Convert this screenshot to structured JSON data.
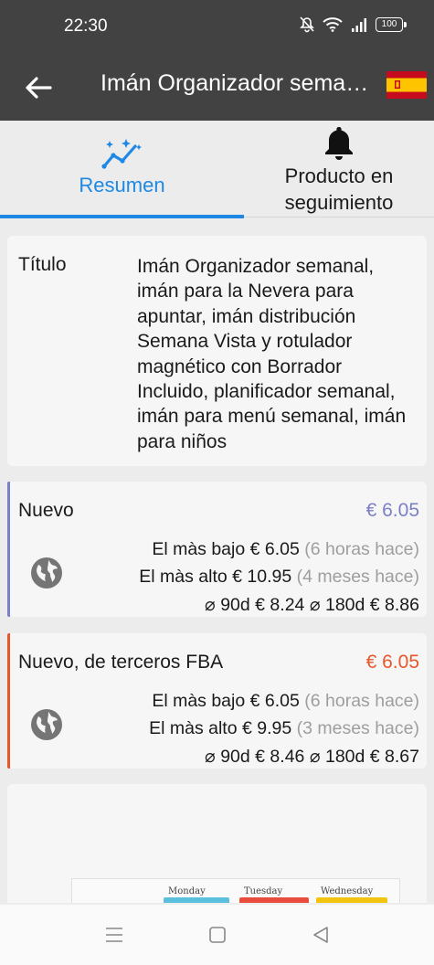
{
  "status_bar": {
    "time": "22:30",
    "battery": "100"
  },
  "app_bar": {
    "title": "Imán Organizador semanal, imán para la Nevera para apuntar"
  },
  "tabs": [
    {
      "label": "Resumen",
      "icon": "trend-sparkle-icon",
      "selected": true
    },
    {
      "label": "Producto en seguimiento",
      "icon": "bell-icon",
      "selected": false
    }
  ],
  "title_card": {
    "label": "Título",
    "value": "Imán Organizador semanal, imán para la Nevera para apuntar, imán distribución Semana Vista y rotulador magnético con Borrador Incluido, planificador semanal, imán para menú semanal, imán para niños"
  },
  "prices": [
    {
      "name": "Nuevo",
      "price": "€ 6.05",
      "color": "#7b7fc4",
      "lowest_label": "El màs bajo",
      "lowest_value": "€ 6.05",
      "lowest_when": "(6 horas hace)",
      "highest_label": "El màs alto",
      "highest_value": "€ 10.95",
      "highest_when": "(4 meses hace)",
      "avg90_label": "⌀ 90d",
      "avg90_value": "€ 8.24",
      "avg180_label": "⌀ 180d",
      "avg180_value": "€ 8.86"
    },
    {
      "name": "Nuevo, de terceros FBA",
      "price": "€ 6.05",
      "color": "#e8572a",
      "lowest_label": "El màs bajo",
      "lowest_value": "€ 6.05",
      "lowest_when": "(6 horas hace)",
      "highest_label": "El màs alto",
      "highest_value": "€ 9.95",
      "highest_when": "(3 meses hace)",
      "avg90_label": "⌀ 90d",
      "avg90_value": "€ 8.46",
      "avg180_label": "⌀ 180d",
      "avg180_value": "€ 8.67"
    }
  ],
  "product_image": {
    "days": [
      "Monday",
      "Tuesday",
      "Wednesday"
    ]
  }
}
